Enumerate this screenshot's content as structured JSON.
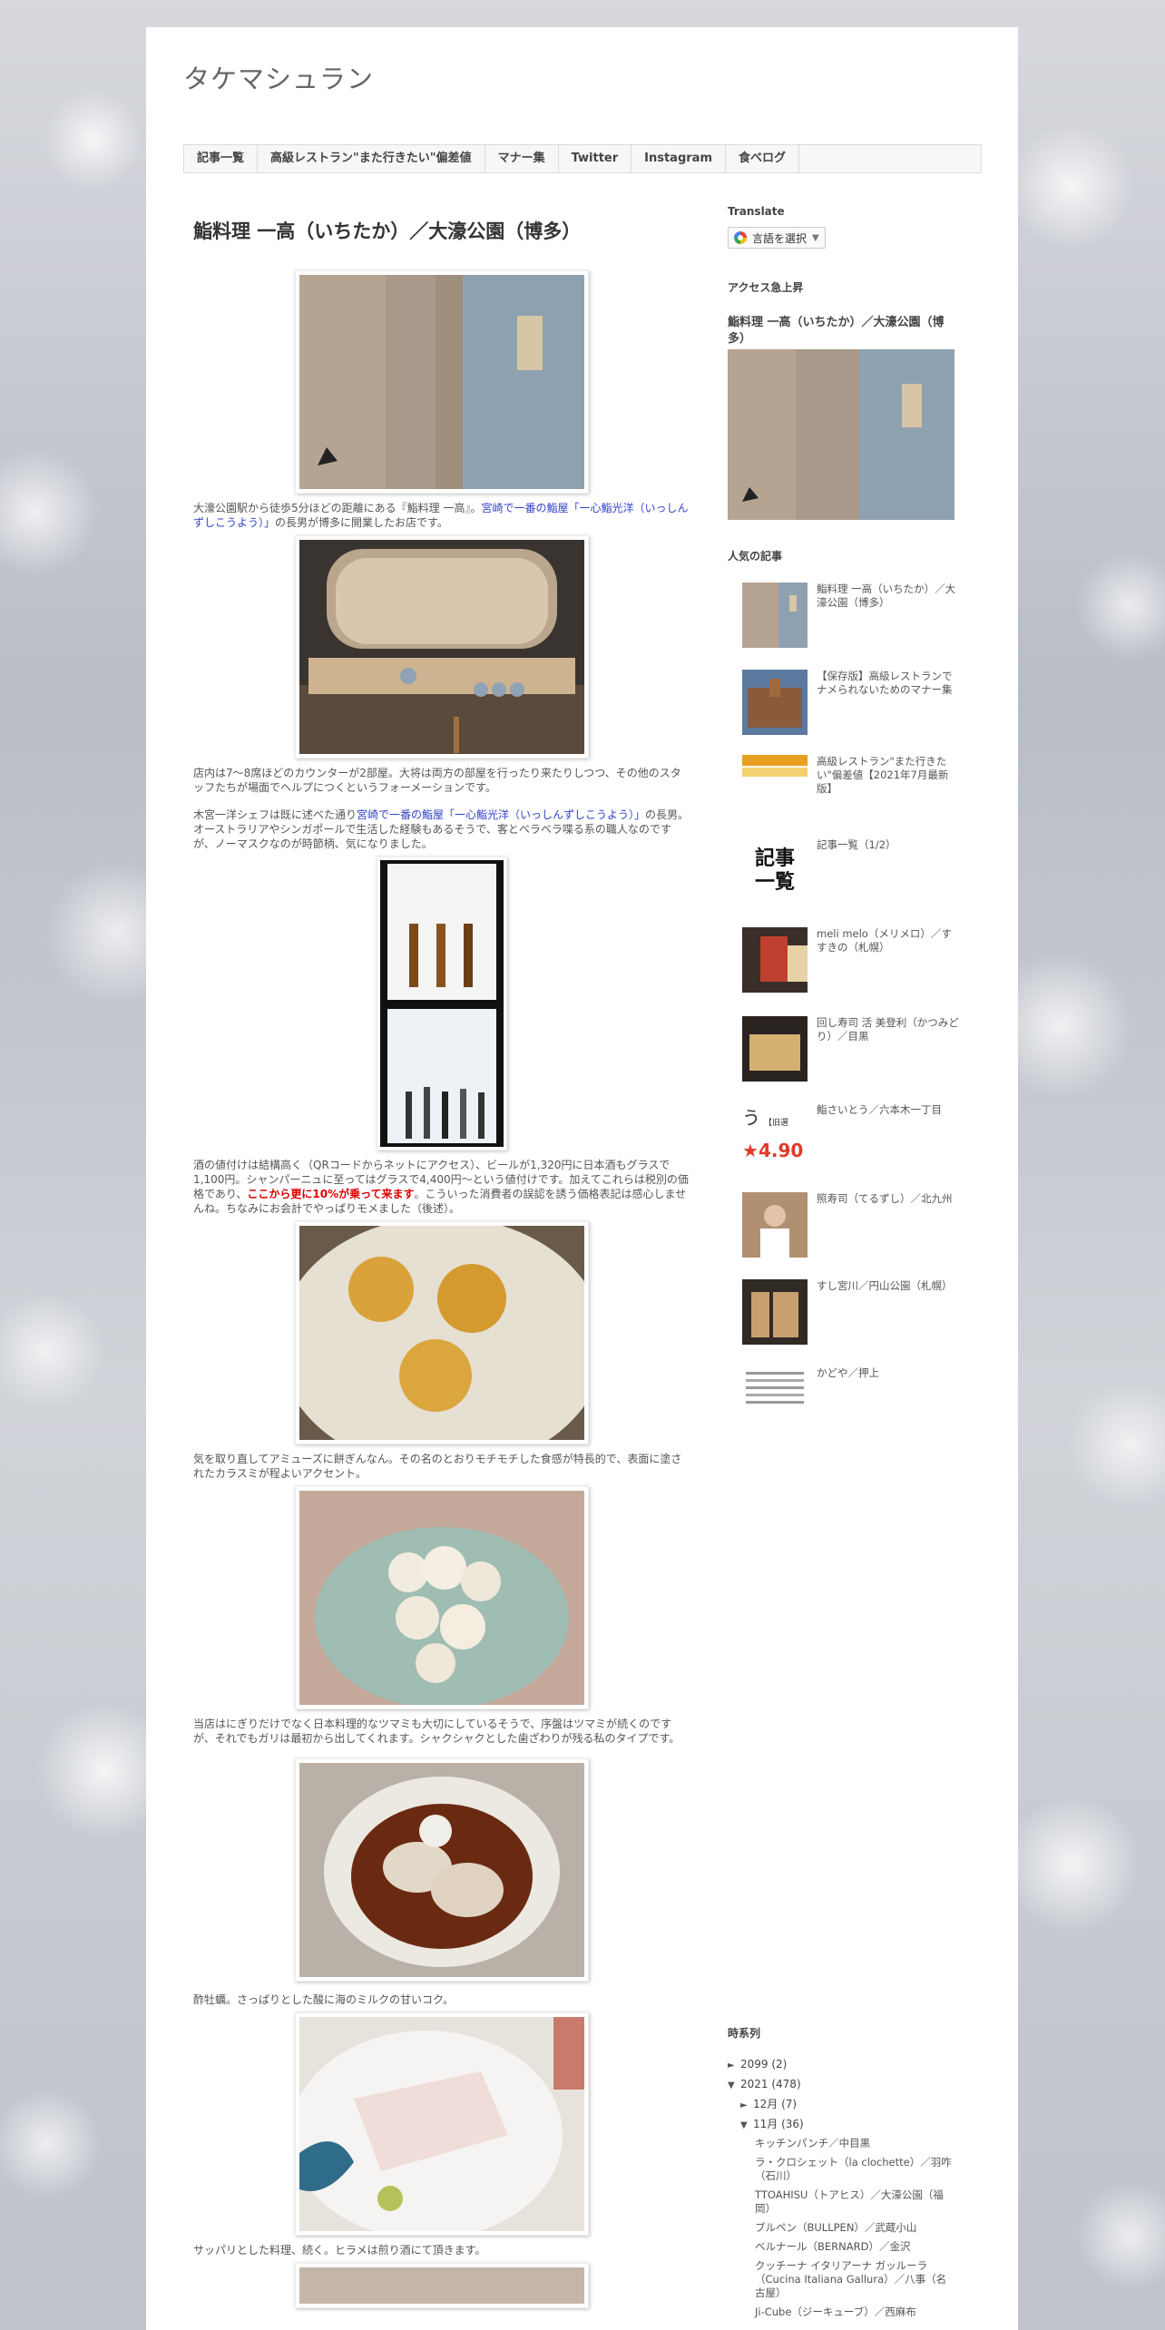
{
  "blog": {
    "title": "タケマシュラン"
  },
  "nav": {
    "tabs": [
      "記事一覧",
      "高級レストラン\"また行きたい\"偏差値",
      "マナー集",
      "Twitter",
      "Instagram",
      "食べログ"
    ]
  },
  "post": {
    "title": "鮨料理 一高（いちたか）／大濠公園（博多）",
    "p1_a": "大濠公園駅から徒歩5分ほどの距離にある『鮨料理 一高』。",
    "p1_link": "宮崎で一番の鮨屋「一心鮨光洋（いっしんずしこうよう）」",
    "p1_b": "の長男が博多に開業したお店です。",
    "p2": "店内は7～8席ほどのカウンターが2部屋。大将は両方の部屋を行ったり来たりしつつ、その他のスタッフたちが場面でヘルプにつくというフォーメーションです。",
    "p3_a": "木宮一洋シェフは既に述べた通り",
    "p3_link": "宮崎で一番の鮨屋「一心鮨光洋（いっしんずしこうよう）」",
    "p3_b": "の長男。オーストラリアやシンガポールで生活した経験もあるそうで、客とベラベラ喋る系の職人なのですが、ノーマスクなのが時節柄、気になりました。",
    "p4_a": "酒の値付けは結構高く（QRコードからネットにアクセス）、ビールが1,320円に日本酒もグラスで1,100円。シャンパーニュに至ってはグラスで4,400円～という値付けです。加えてこれらは税別の価格であり、",
    "p4_red": "ここから更に10%が乗って来ます",
    "p4_b": "。こういった消費者の誤認を誘う価格表記は感心しませんね。ちなみにお会計でやっぱりモメました（後述）。",
    "p5": "気を取り直してアミューズに餅ぎんなん。その名のとおりモチモチした食感が特長的で、表面に塗されたカラスミが程よいアクセント。",
    "p6": "当店はにぎりだけでなく日本料理的なツマミも大切にしているそうで、序盤はツマミが続くのですが、それでもガリは最初から出してくれます。シャクシャクとした歯ざわりが残る私のタイプです。",
    "p7": "酢牡蠣。さっぱりとした酸に海のミルクの甘いコク。",
    "p8": "サッパリとした料理、続く。ヒラメは煎り酒にて頂きます。"
  },
  "sidebar": {
    "translate_heading": "Translate",
    "translate_button": "言語を選択",
    "trending_heading": "アクセス急上昇",
    "trending_title": "鮨料理 一高（いちたか）／大濠公園（博多）",
    "popular_heading": "人気の記事",
    "popular": [
      "鮨料理 一高（いちたか）／大濠公園（博多）",
      "【保存版】高級レストランでナメられないためのマナー集",
      "高級レストラン\"また行きたい\"偏差値【2021年7月最新版】",
      "記事一覧（1/2）",
      "meli melo（メリメロ）／すすきの（札幌）",
      "回し寿司 活 美登利（かつみどり）／目黒",
      "鮨さいとう／六本木一丁目",
      "照寿司（てるずし）／北九州",
      "すし宮川／円山公園（札幌）",
      "かどや／押上"
    ],
    "popular_thumb_text": {
      "kiji_line1": "記事",
      "kiji_line2": "一覧",
      "rating": "4.90",
      "rating_label": "【旧選"
    },
    "archive_heading": "時系列",
    "archive": {
      "y2099": "2099 (2)",
      "y2021": "2021 (478)",
      "m12": "12月 (7)",
      "m11": "11月 (36)",
      "entries": [
        "キッチンパンチ／中目黒",
        "ラ・クロシェット（la clochette）／羽咋（石川）",
        "TTOAHISU（トアヒス）／大濠公園（福岡）",
        "ブルペン（BULLPEN）／武蔵小山",
        "ベルナール（BERNARD）／金沢",
        "クッチーナ イタリアーナ ガッルーラ（Cucina Italiana Gallura）／八事（名古屋）",
        "Ji-Cube（ジーキューブ）／西麻布"
      ]
    }
  }
}
